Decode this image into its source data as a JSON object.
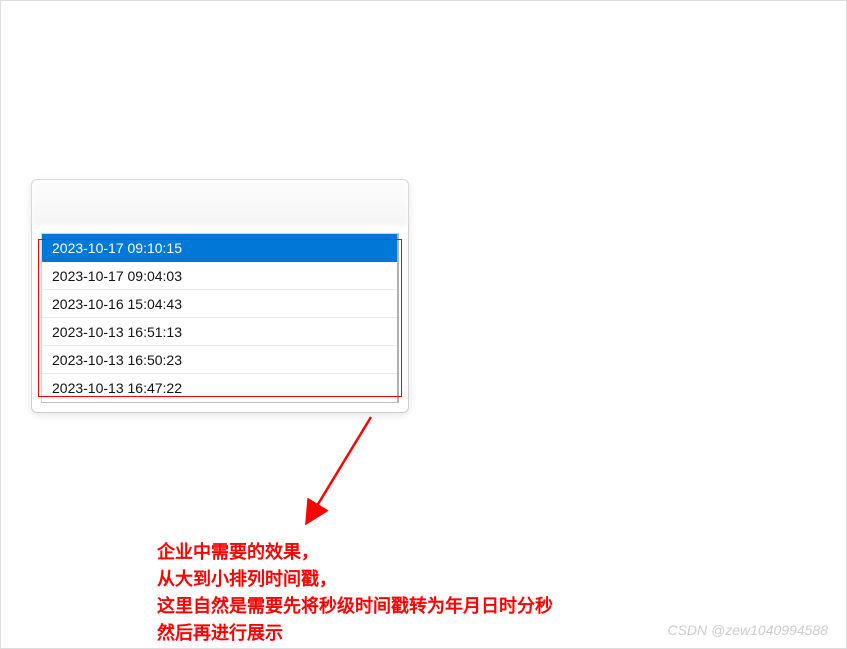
{
  "window": {
    "header_title": ""
  },
  "timestamps": [
    {
      "value": "2023-10-17 09:10:15",
      "selected": true
    },
    {
      "value": "2023-10-17 09:04:03",
      "selected": false
    },
    {
      "value": "2023-10-16 15:04:43",
      "selected": false
    },
    {
      "value": "2023-10-13 16:51:13",
      "selected": false
    },
    {
      "value": "2023-10-13 16:50:23",
      "selected": false
    },
    {
      "value": "2023-10-13 16:47:22",
      "selected": false
    }
  ],
  "annotation": {
    "line1": "企业中需要的效果，",
    "line2": "从大到小排列时间戳，",
    "line3": "这里自然是需要先将秒级时间戳转为年月日时分秒",
    "line4": "然后再进行展示"
  },
  "watermark": "CSDN @zew1040994588"
}
